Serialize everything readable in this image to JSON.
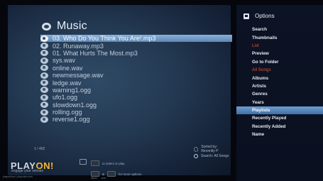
{
  "main": {
    "title": "Music",
    "files": [
      "03. Who Do You Think You Are!.mp3",
      "02. Runaway.mp3",
      "01. What Hurts The Most.mp3",
      "sys.wav",
      "online.wav",
      "newmessage.wav",
      "ledge.wav",
      "warning1.ogg",
      "ufo1.ogg",
      "slowdown1.ogg",
      "rolling.ogg",
      "reverse1.ogg"
    ],
    "selected_index": 0,
    "counter": "1 / 402",
    "sorted_by": "Sorted by: Recently P",
    "search": "Search: All Songs"
  },
  "bottom": {
    "logo_play": "PLAY",
    "logo_on": "ON!",
    "tagline": "engage your senses",
    "site": "playonlinux | playonlm.com",
    "hint_select": "to select or play",
    "hint_more": "for more options",
    "label_menu": "MENU",
    "label_exit": "EXIT",
    "amp": "&"
  },
  "options": {
    "title": "Options",
    "items": [
      {
        "label": "Search",
        "style": "normal"
      },
      {
        "label": "Thumbnails",
        "style": "normal"
      },
      {
        "label": "List",
        "style": "red"
      },
      {
        "label": "Preview",
        "style": "normal"
      },
      {
        "label": "Go to Folder",
        "style": "normal"
      },
      {
        "label": "All Songs",
        "style": "red"
      },
      {
        "label": "Albums",
        "style": "normal"
      },
      {
        "label": "Artists",
        "style": "normal"
      },
      {
        "label": "Genres",
        "style": "normal"
      },
      {
        "label": "Years",
        "style": "normal"
      },
      {
        "label": "Playlists",
        "style": "highlight"
      },
      {
        "label": "Recently Played",
        "style": "normal"
      },
      {
        "label": "Recently Added",
        "style": "normal"
      },
      {
        "label": "Name",
        "style": "normal"
      }
    ]
  },
  "colors": {
    "accent": "#f3b733",
    "selection": "#5d87b6",
    "red_option": "#d8543f"
  }
}
